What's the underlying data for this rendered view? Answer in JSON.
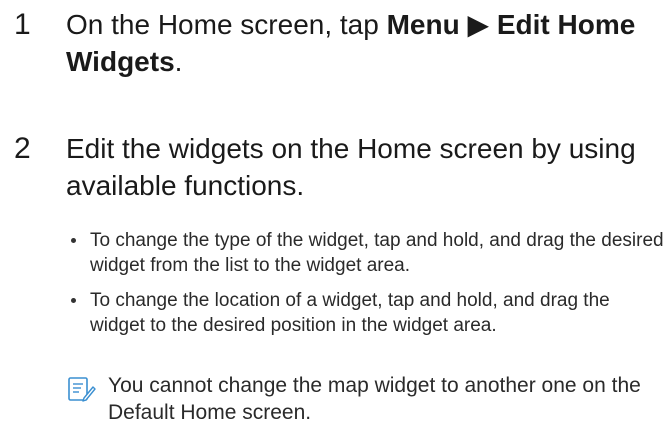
{
  "steps": [
    {
      "number": "1",
      "prefix": "On the Home screen, tap ",
      "menu": "Menu",
      "arrow": "▶",
      "action": "Edit Home Widgets",
      "suffix": "."
    },
    {
      "number": "2",
      "text": "Edit the widgets on the Home screen by using available functions."
    }
  ],
  "bullets": [
    "To change the type of the widget, tap and hold, and drag the desired widget from the list to the widget area.",
    "To change the location of a widget, tap and hold, and drag the widget to the desired position in the widget area."
  ],
  "note": {
    "icon": "note-icon",
    "text": "You cannot change the map widget to another one on the Default Home screen."
  },
  "colors": {
    "text": "#1a1a1a",
    "icon": "#3a8fd1"
  }
}
